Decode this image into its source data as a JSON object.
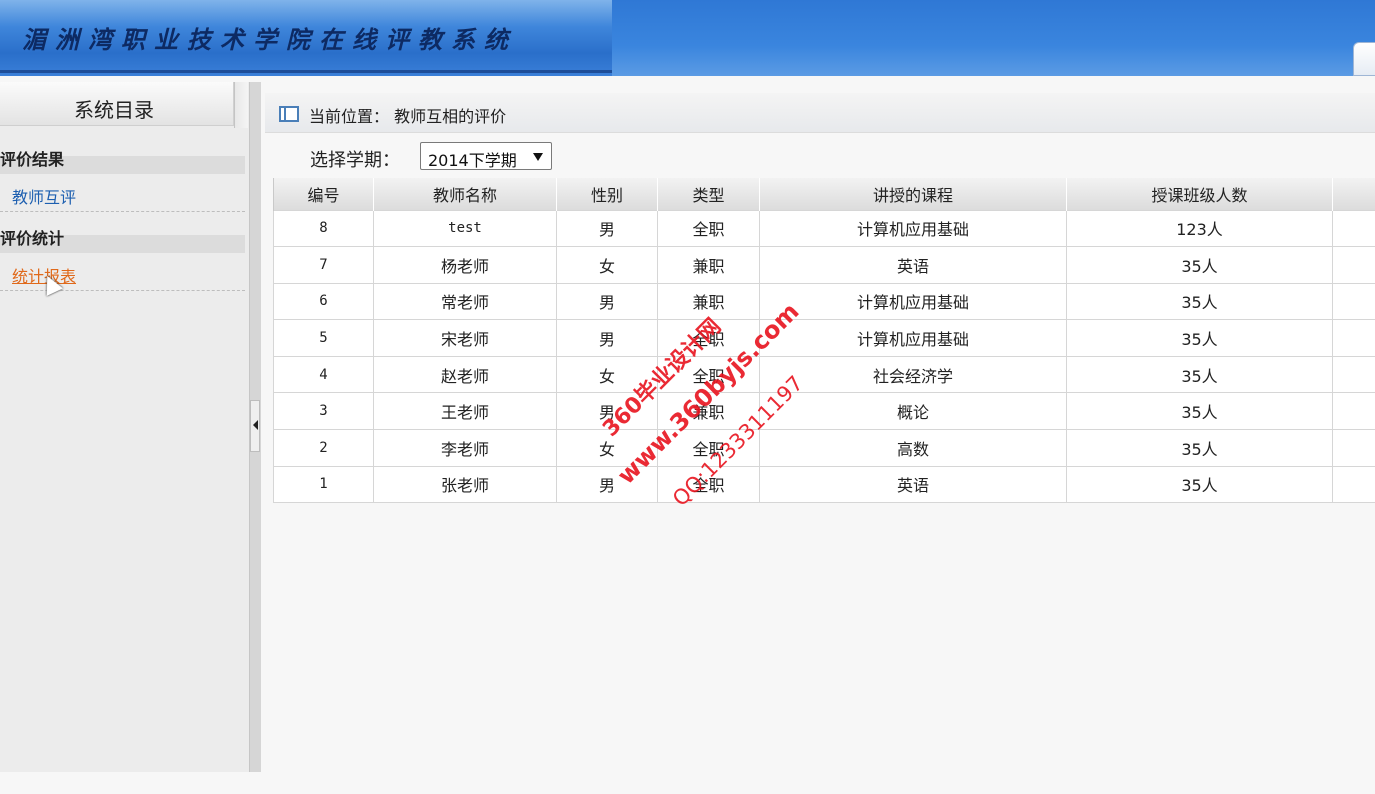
{
  "header": {
    "title": "湄洲湾职业技术学院在线评教系统"
  },
  "sidebar": {
    "title": "系统目录",
    "groups": [
      {
        "label": "评价结果",
        "items": [
          {
            "label": "教师互评"
          }
        ]
      },
      {
        "label": "评价统计",
        "items": [
          {
            "label": "统计报表"
          }
        ]
      }
    ]
  },
  "breadcrumb": {
    "text": "当前位置： 教师互相的评价"
  },
  "term": {
    "label": "选择学期：",
    "selected": "2014下学期"
  },
  "table": {
    "headers": [
      "编号",
      "教师名称",
      "性别",
      "类型",
      "讲授的课程",
      "授课班级人数",
      ""
    ],
    "rows": [
      [
        "8",
        "test",
        "男",
        "全职",
        "计算机应用基础",
        "123人"
      ],
      [
        "7",
        "杨老师",
        "女",
        "兼职",
        "英语",
        "35人"
      ],
      [
        "6",
        "常老师",
        "男",
        "兼职",
        "计算机应用基础",
        "35人"
      ],
      [
        "5",
        "宋老师",
        "男",
        "全职",
        "计算机应用基础",
        "35人"
      ],
      [
        "4",
        "赵老师",
        "女",
        "全职",
        "社会经济学",
        "35人"
      ],
      [
        "3",
        "王老师",
        "男",
        "兼职",
        "概论",
        "35人"
      ],
      [
        "2",
        "李老师",
        "女",
        "全职",
        "高数",
        "35人"
      ],
      [
        "1",
        "张老师",
        "男",
        "全职",
        "英语",
        "35人"
      ]
    ]
  },
  "watermark": {
    "line1": "360毕业设计网",
    "line2": "www.360byjs.com",
    "line3": "QQ:1233311197"
  }
}
